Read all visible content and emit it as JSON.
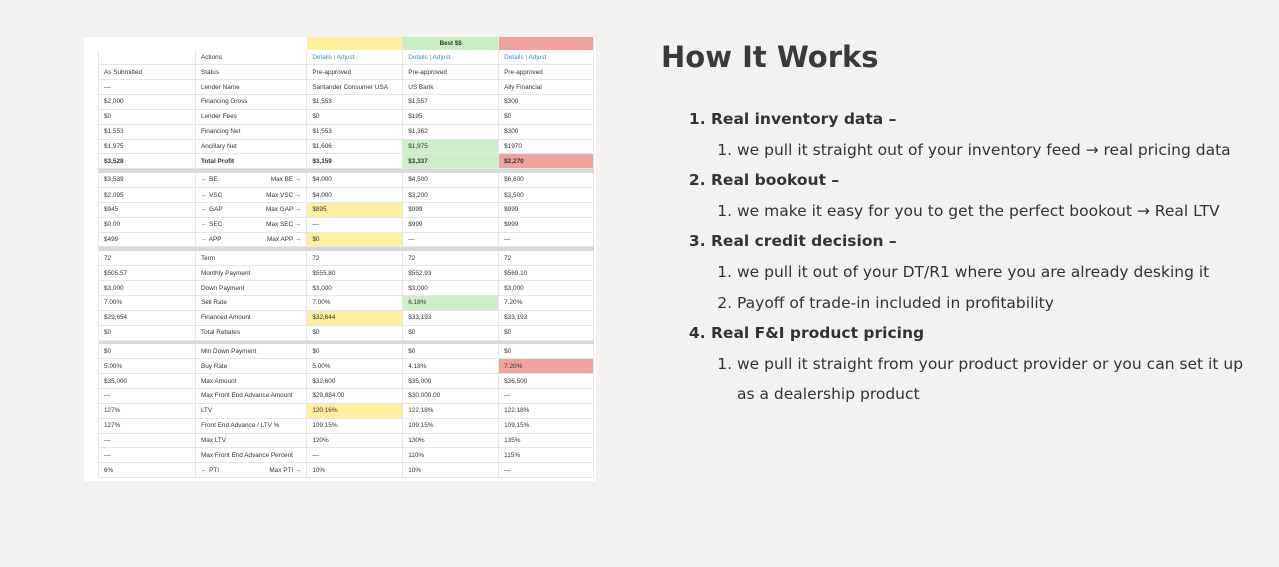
{
  "table": {
    "header": {
      "col2": "",
      "col3": "Best $$",
      "col4": ""
    },
    "sections": [
      [
        {
          "c": [
            "",
            "Actions",
            "@links",
            "@links",
            "@links"
          ]
        },
        {
          "c": [
            "As Submitted",
            "Status",
            "Pre-approved",
            "Pre-approved",
            "Pre-approved"
          ]
        },
        {
          "c": [
            "—",
            "Lender Name",
            "Santander Consumer USA",
            "US Bank",
            "Ally Financial"
          ]
        },
        {
          "c": [
            "$2,000",
            "Financing Gross",
            "$1,553",
            "$1,557",
            "$300"
          ]
        },
        {
          "c": [
            "$0",
            "Lender Fees",
            "$0",
            "$195",
            "$0"
          ]
        },
        {
          "c": [
            "$1,553",
            "Financing Net",
            "$1,553",
            "$1,362",
            "$300"
          ]
        },
        {
          "c": [
            "$1,975",
            "Ancillary Net",
            "$1,606",
            "$1,975",
            "$1970"
          ],
          "hl": [
            "",
            "",
            "",
            "g",
            ""
          ]
        },
        {
          "c": [
            "$3,528",
            "Total Profit",
            "$3,159",
            "$3,337",
            "$2,270"
          ],
          "hl": [
            "",
            "",
            "",
            "g",
            "r"
          ],
          "total": true
        }
      ],
      [
        {
          "c": [
            "$3,539",
            "← BE|Max BE →",
            "$4,000",
            "$4,500",
            "$6,600"
          ]
        },
        {
          "c": [
            "$2,095",
            "← VSC|Max VSC →",
            "$4,000",
            "$3,200",
            "$3,500"
          ]
        },
        {
          "c": [
            "$945",
            "← GAP|Max GAP →",
            "$895",
            "$999",
            "$999"
          ],
          "hl": [
            "",
            "",
            "y",
            "",
            ""
          ]
        },
        {
          "c": [
            "$0.00",
            "← SEC|Max SEC →",
            "—",
            "$999",
            "$999"
          ]
        },
        {
          "c": [
            "$499",
            "← APP|Max APP →",
            "$0",
            "—",
            "—"
          ],
          "hl": [
            "",
            "",
            "y",
            "",
            ""
          ]
        }
      ],
      [
        {
          "c": [
            "72",
            "Term",
            "72",
            "72",
            "72"
          ]
        },
        {
          "c": [
            "$505.57",
            "Monthly Payment",
            "$555.80",
            "$552.93",
            "$569.10"
          ]
        },
        {
          "c": [
            "$3,000",
            "Down Payment",
            "$3,000",
            "$3,000",
            "$3,000"
          ]
        },
        {
          "c": [
            "7.00%",
            "Sell Rate",
            "7.00%",
            "6.18%",
            "7.20%"
          ],
          "hl": [
            "",
            "",
            "",
            "g",
            ""
          ]
        },
        {
          "c": [
            "$29,654",
            "Financed Amount",
            "$32,644",
            "$33,193",
            "$33,193"
          ],
          "hl": [
            "",
            "",
            "y",
            "",
            ""
          ]
        },
        {
          "c": [
            "$0",
            "Total Rebates",
            "$0",
            "$0",
            "$0"
          ]
        }
      ],
      [
        {
          "c": [
            "$0",
            "Min Down Payment",
            "$0",
            "$0",
            "$0"
          ]
        },
        {
          "c": [
            "5.00%",
            "Buy Rate",
            "5.00%",
            "4.18%",
            "7.20%"
          ],
          "hl": [
            "",
            "",
            "",
            "",
            "r"
          ]
        },
        {
          "c": [
            "$35,000",
            "Max Amount",
            "$32,600",
            "$35,000",
            "$36,500"
          ]
        },
        {
          "c": [
            "—",
            "Max Front End Advance Amount",
            "$29,884.00",
            "$30,000.00",
            "—"
          ]
        },
        {
          "c": [
            "127%",
            "LTV",
            "120.16%",
            "122.18%",
            "122.18%"
          ],
          "hl": [
            "",
            "",
            "y",
            "",
            ""
          ]
        },
        {
          "c": [
            "127%",
            "Front End Advance / LTV %",
            "109.15%",
            "109.15%",
            "109.15%"
          ]
        },
        {
          "c": [
            "—",
            "Max LTV",
            "120%",
            "130%",
            "135%"
          ]
        },
        {
          "c": [
            "—",
            "Max Front End Advance Percent",
            "—",
            "110%",
            "115%"
          ]
        },
        {
          "c": [
            "6%",
            "← PTI|Max PTI →",
            "10%",
            "10%",
            "—"
          ]
        }
      ]
    ],
    "links": {
      "details": "Details",
      "sep": "|",
      "adjust": "Adjust"
    },
    "colors": {
      "yellow": "#fdef9f",
      "green": "#c9ecc3",
      "red": "#eea39f",
      "link": "#3b8fd0"
    }
  },
  "content": {
    "title": "How It Works",
    "items": [
      {
        "label": "Real inventory data –",
        "sub": [
          "we pull it straight out of your inventory feed → real pricing data"
        ]
      },
      {
        "label": "Real bookout –",
        "sub": [
          "we make it easy for you to get the perfect bookout → Real LTV"
        ]
      },
      {
        "label": "Real credit decision –",
        "sub": [
          "we pull it out of your DT/R1 where you are already desking it",
          "Payoff of trade-in included in profitability"
        ]
      },
      {
        "label": "Real F&I product pricing",
        "sub": [
          "we pull it straight from your product provider or you can set it up as a dealership product"
        ]
      }
    ]
  }
}
